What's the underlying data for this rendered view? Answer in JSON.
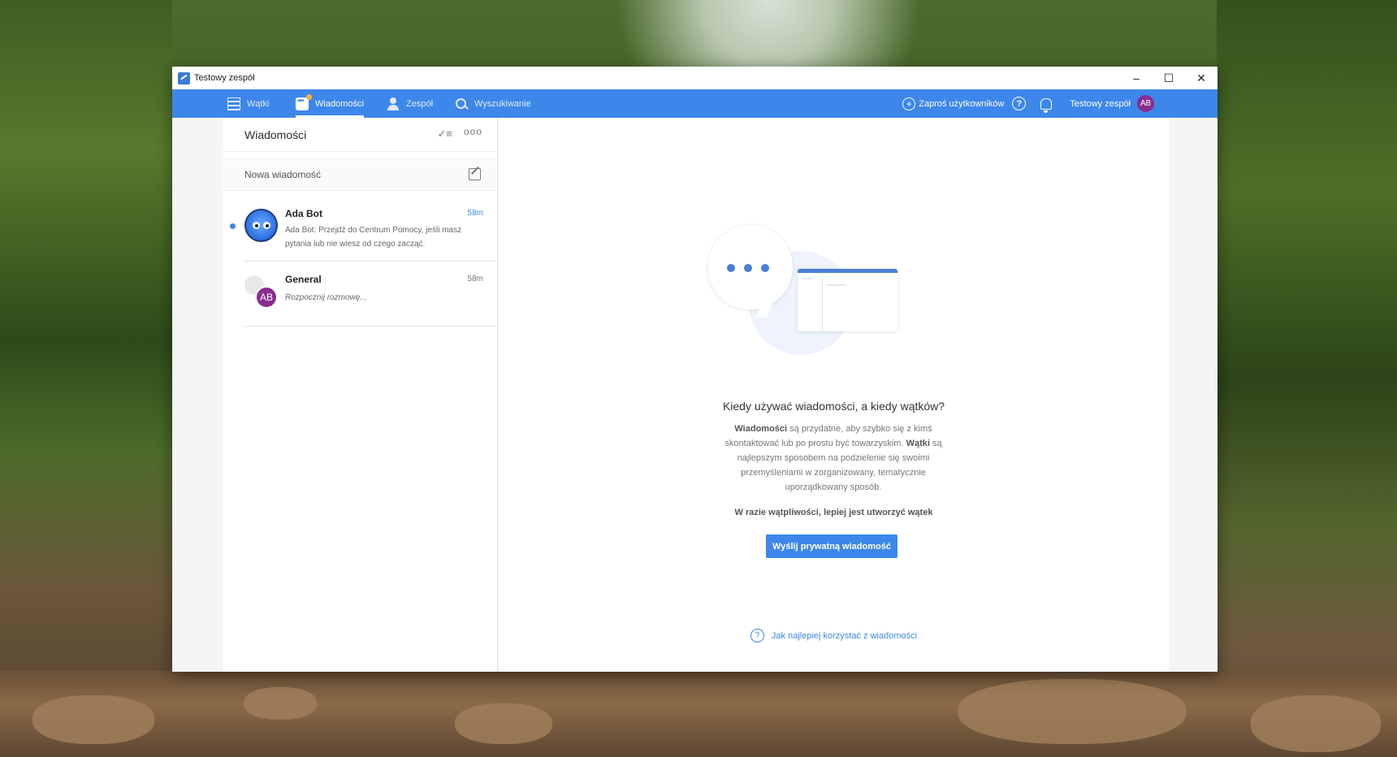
{
  "window": {
    "title": "Testowy zespół",
    "controls": {
      "minimize": "–",
      "maximize": "☐",
      "close": "✕"
    }
  },
  "nav": {
    "items": [
      {
        "label": "Wątki",
        "icon": "threads-icon"
      },
      {
        "label": "Wiadomości",
        "icon": "chat-icon",
        "active": true
      },
      {
        "label": "Zespół",
        "icon": "team-icon"
      },
      {
        "label": "Wyszukiwanie",
        "icon": "search-icon"
      }
    ],
    "invite_label": "Zaproś użytkowników",
    "invite_glyph": "+",
    "help_glyph": "?",
    "team_name": "Testowy zespół",
    "user_initials": "AB"
  },
  "sidebar": {
    "title": "Wiadomości",
    "check_glyph": "✓≡",
    "more_glyph": "ooo",
    "new_message_label": "Nowa wiadomość",
    "conversations": [
      {
        "name": "Ada Bot",
        "time": "58m",
        "preview": "Ada Bot: Przejdź do Centrum Pomocy, jeśli masz pytania lub nie wiesz od czego zacząć.",
        "unread": true
      },
      {
        "name": "General",
        "time": "58m",
        "preview": "Rozpocznij rozmowę...",
        "avatar_initials": "AB"
      }
    ]
  },
  "main": {
    "heading": "Kiedy używać wiadomości, a kiedy wątków?",
    "body_bold_1": "Wiadomości",
    "body_part_1": " są przydatne, aby szybko się z kimś skontaktować lub po prostu być towarzyskim. ",
    "body_bold_2": "Wątki",
    "body_part_2": " są najlepszym sposobem na podzielenie się swoimi przemyśleniami w zorganizowany, tematycznie uporządkowany sposób.",
    "body_strong": "W razie wątpliwości, lepiej jest utworzyć wątek",
    "cta_label": "Wyślij prywatną wiadomość",
    "help_glyph": "?",
    "help_link": "Jak najlepiej korzystać z wiadomości"
  },
  "colors": {
    "accent": "#3d87ea",
    "avatar": "#8a2d8f",
    "unread": "#3d87ea"
  }
}
